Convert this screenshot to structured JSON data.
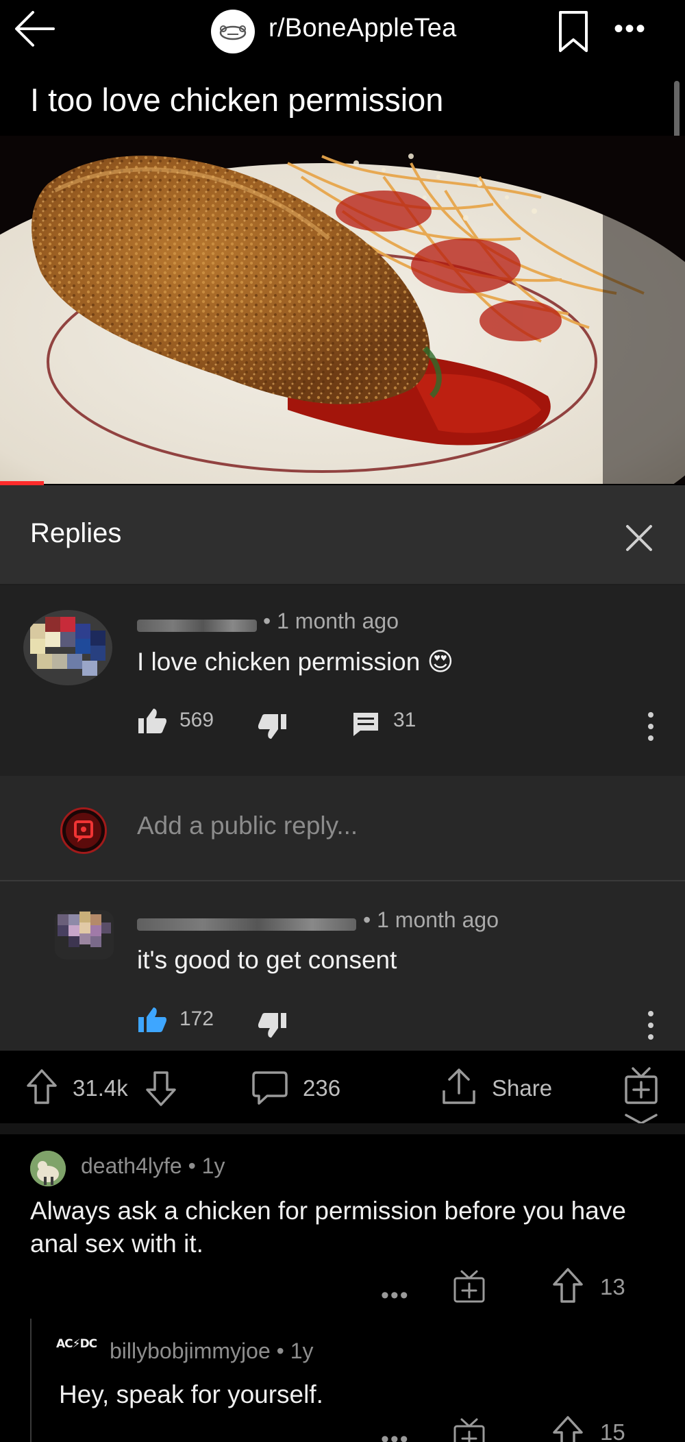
{
  "header": {
    "back_icon": "arrow-left-icon",
    "subreddit": "r/BoneAppleTea",
    "bookmark_icon": "bookmark-icon",
    "more_icon": "more-horizontal-icon",
    "more_label": "•••"
  },
  "post": {
    "title": "I too love chicken permission",
    "image_icon": "chicken-parmesan-photo"
  },
  "replies_panel": {
    "title": "Replies",
    "close_icon": "close-icon",
    "comments": [
      {
        "meta": "• 1 month ago",
        "text": "I love chicken permission",
        "emoji": "😍",
        "likes": "569",
        "replies_count": "31"
      },
      {
        "meta": "• 1 month ago",
        "text": "it's good to get consent",
        "likes": "172"
      }
    ],
    "reply_placeholder": "Add a public reply..."
  },
  "action_bar": {
    "upvotes": "31.4k",
    "comments": "236",
    "share": "Share"
  },
  "reddit_comments": [
    {
      "user": "death4lyfe",
      "age": "• 1y",
      "text": "Always ask a chicken for permission before you have anal sex with it.",
      "dots": "•••",
      "votes": "13"
    },
    {
      "user": "billybobjimmyjoe",
      "age": "• 1y",
      "text": "Hey, speak for yourself.",
      "dots": "•••",
      "votes": "15",
      "avatar_text": "AC⚡DC"
    }
  ],
  "colors": {
    "background": "#000000",
    "panel": "#272727",
    "like_active": "#3ea6ff",
    "progress": "#ff2b2b"
  }
}
